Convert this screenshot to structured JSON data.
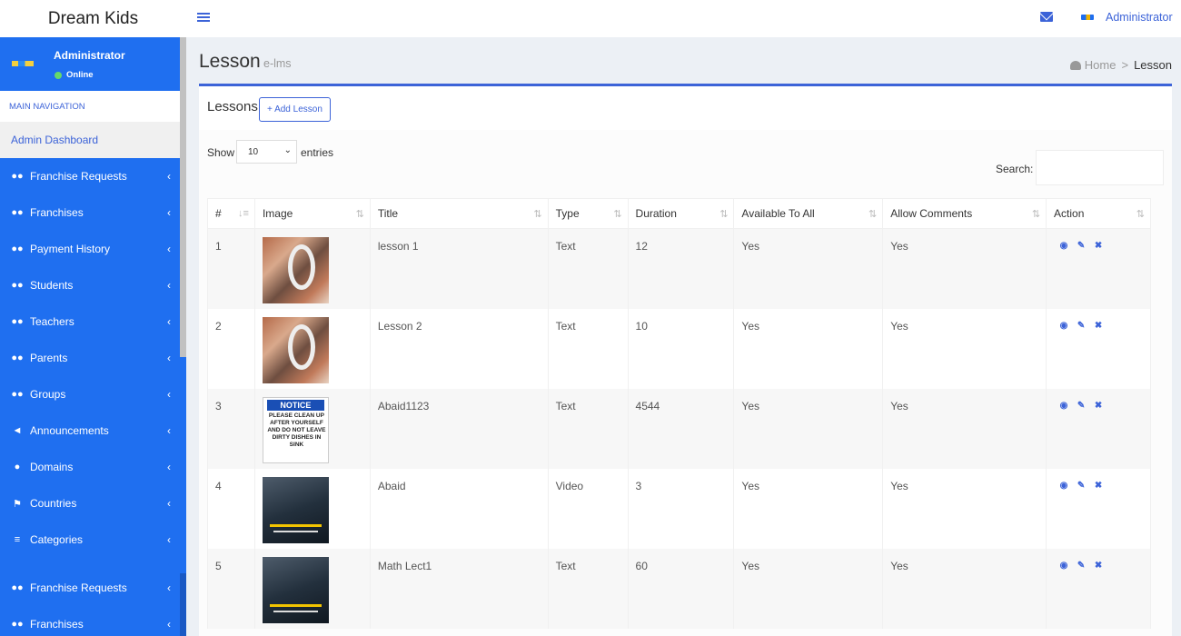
{
  "brand": "Dream Kids",
  "header": {
    "user_name": "Administrator"
  },
  "sidebar": {
    "user_name": "Administrator",
    "status": "Online",
    "nav_header": "MAIN NAVIGATION",
    "active_item": "Admin Dashboard",
    "items": [
      {
        "label": "Franchise Requests",
        "icon": "users-icon"
      },
      {
        "label": "Franchises",
        "icon": "users-icon"
      },
      {
        "label": "Payment History",
        "icon": "users-icon"
      },
      {
        "label": "Students",
        "icon": "users-icon"
      },
      {
        "label": "Teachers",
        "icon": "users-icon"
      },
      {
        "label": "Parents",
        "icon": "users-icon"
      },
      {
        "label": "Groups",
        "icon": "users-icon"
      },
      {
        "label": "Announcements",
        "icon": "bullhorn-icon"
      },
      {
        "label": "Domains",
        "icon": "globe-icon"
      },
      {
        "label": "Countries",
        "icon": "flag-icon"
      },
      {
        "label": "Categories",
        "icon": "list-icon"
      }
    ],
    "items_repeat": [
      {
        "label": "Franchise Requests",
        "icon": "users-icon"
      },
      {
        "label": "Franchises",
        "icon": "users-icon"
      }
    ]
  },
  "page": {
    "title": "Lesson",
    "subtitle": "e-lms",
    "breadcrumb_home": "Home",
    "breadcrumb_current": "Lesson"
  },
  "box": {
    "title": "Lessons",
    "add_button": "+ Add Lesson",
    "show_label": "Show",
    "entries_value": "10",
    "entries_label": "entries",
    "search_label": "Search:"
  },
  "table": {
    "columns": [
      "#",
      "Image",
      "Title",
      "Type",
      "Duration",
      "Available To All",
      "Allow Comments",
      "Action"
    ],
    "rows": [
      {
        "num": "1",
        "image": "photo",
        "title": "lesson 1",
        "type": "Text",
        "duration": "12",
        "available": "Yes",
        "comments": "Yes"
      },
      {
        "num": "2",
        "image": "photo",
        "title": "Lesson 2",
        "type": "Text",
        "duration": "10",
        "available": "Yes",
        "comments": "Yes"
      },
      {
        "num": "3",
        "image": "notice",
        "title": "Abaid1123",
        "type": "Text",
        "duration": "4544",
        "available": "Yes",
        "comments": "Yes"
      },
      {
        "num": "4",
        "image": "dark",
        "title": "Abaid",
        "type": "Video",
        "duration": "3",
        "available": "Yes",
        "comments": "Yes"
      },
      {
        "num": "5",
        "image": "dark",
        "title": "Math Lect1",
        "type": "Text",
        "duration": "60",
        "available": "Yes",
        "comments": "Yes"
      }
    ],
    "notice_heading": "NOTICE",
    "notice_text": "PLEASE CLEAN UP AFTER YOURSELF AND DO NOT LEAVE DIRTY DISHES IN SINK"
  },
  "colors": {
    "primary": "#1f6ff0",
    "accent": "#3c63d8",
    "background": "#ecf0f5"
  }
}
